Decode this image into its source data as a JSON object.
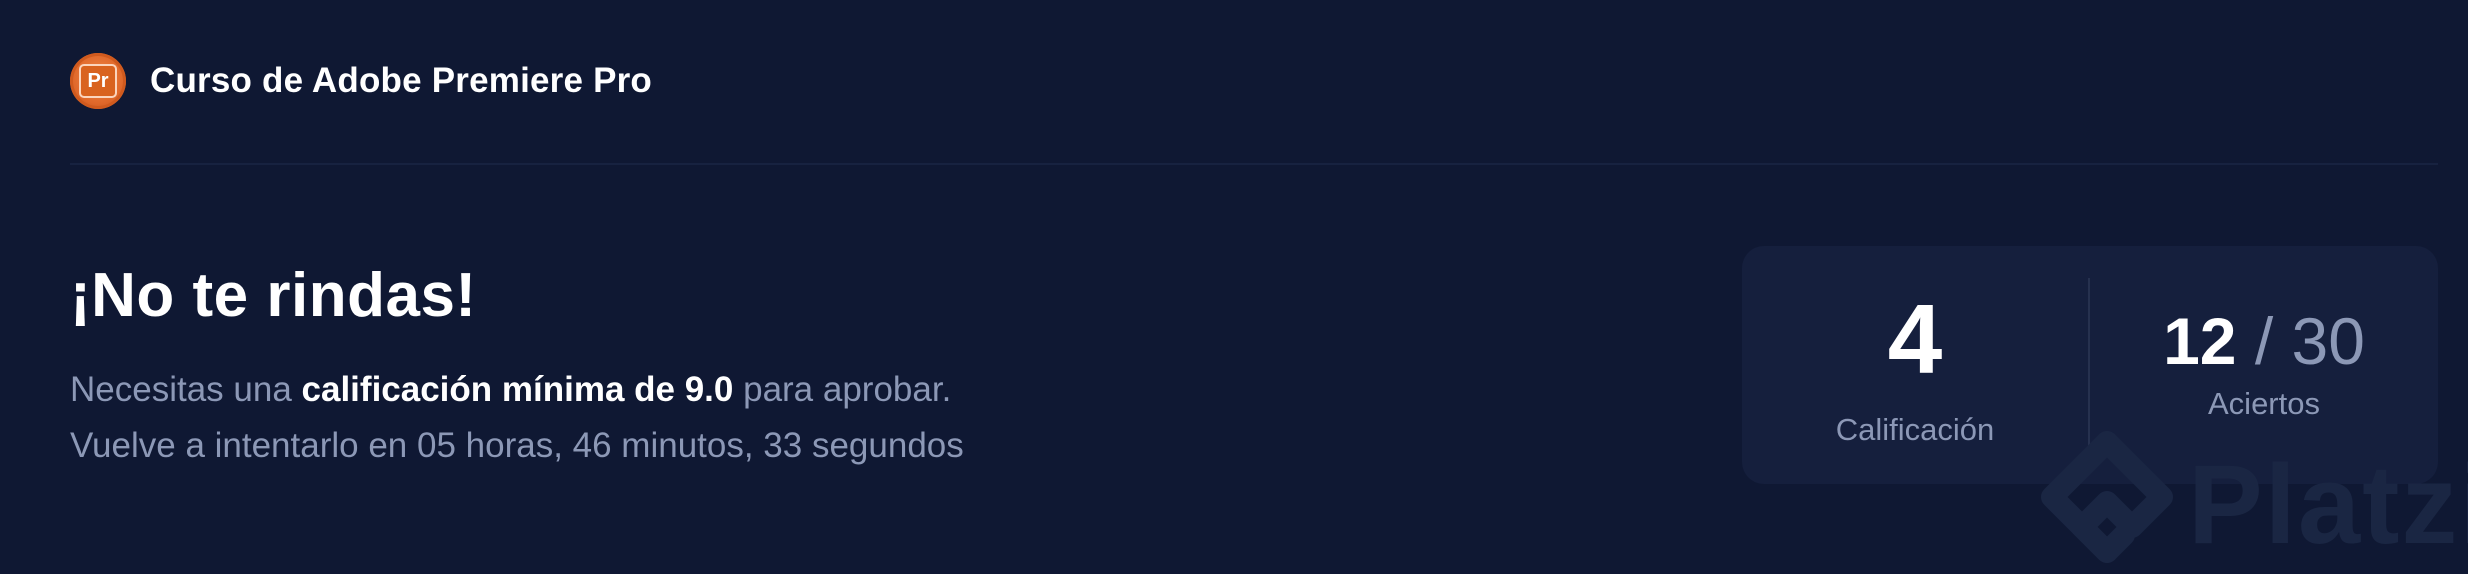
{
  "header": {
    "course_icon": "adobe-premiere-pro-icon",
    "course_icon_text": "Pr",
    "course_title": "Curso de Adobe Premiere Pro"
  },
  "result": {
    "headline": "¡No te rindas!",
    "line1_prefix": "Necesitas una ",
    "line1_strong": "calificación mínima de 9.0",
    "line1_suffix": " para aprobar.",
    "line2": "Vuelve a intentarlo en 05 horas, 46 minutos, 33 segundos"
  },
  "score": {
    "grade_value": "4",
    "grade_label": "Calificación",
    "hits_value": "12",
    "hits_separator": "/",
    "hits_total": "30",
    "hits_label": "Aciertos"
  },
  "watermark": {
    "icon": "platzi-logo-icon",
    "text": "Platzi"
  },
  "colors": {
    "background": "#0f1833",
    "card": "#151f3d",
    "text_primary": "#ffffff",
    "text_secondary": "#8c98b6",
    "accent_orange": "#e0682a"
  }
}
